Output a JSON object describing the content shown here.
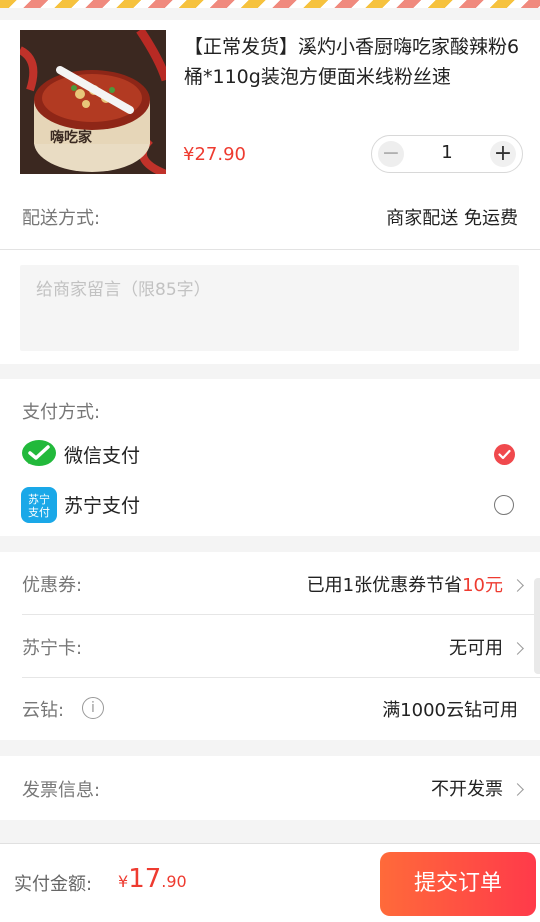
{
  "product": {
    "title": "【正常发货】溪灼小香厨嗨吃家酸辣粉6桶*110g装泡方便面米线粉丝速",
    "price": "¥27.90",
    "quantity": "1",
    "minus": "−",
    "plus": "+"
  },
  "delivery": {
    "label": "配送方式:",
    "value": "商家配送  免运费"
  },
  "message": {
    "placeholder": "给商家留言（限85字）"
  },
  "payment": {
    "label": "支付方式:",
    "options": [
      {
        "name": "微信支付",
        "selected": true
      },
      {
        "name": "苏宁支付",
        "icon_text": "苏宁\n支付",
        "selected": false
      }
    ]
  },
  "coupon": {
    "label": "优惠券:",
    "value_prefix": "已用1张优惠券节省",
    "value_amount": "10元"
  },
  "suning_card": {
    "label": "苏宁卡:",
    "value": "无可用"
  },
  "yunzuan": {
    "label": "云钻:",
    "value": "满1000云钻可用"
  },
  "invoice": {
    "label": "发票信息:",
    "value": "不开发票"
  },
  "footer": {
    "total_label": "实付金额:",
    "currency": "¥",
    "amount_int": "17",
    "amount_dec": ".90",
    "submit": "提交订单"
  },
  "colors": {
    "accent": "#ee3b30",
    "wechat": "#22b93b",
    "suning": "#1aa8e8"
  }
}
